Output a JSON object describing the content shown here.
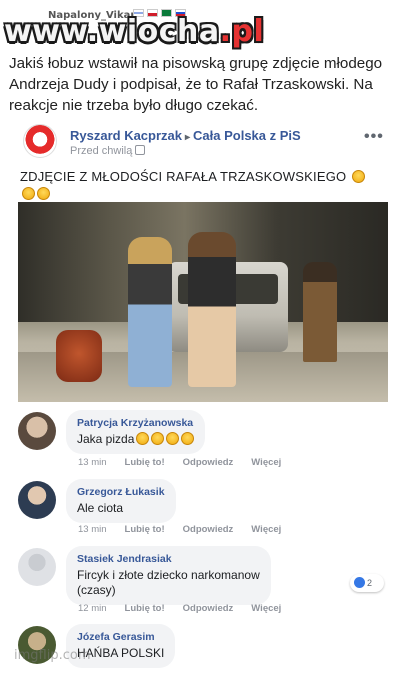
{
  "watermark": {
    "user": "Napalony_Vikar",
    "logo_main": "www.wiocha",
    "logo_dot_pl": ".pl",
    "footer": "imgflip.com"
  },
  "caption": "Jakiś łobuz wstawił na pisowską grupę zdjęcie młodego Andrzeja Dudy i podpisał, że to Rafał Trzaskowski. Na reakcje nie trzeba było długo czekać.",
  "post": {
    "author": "Ryszard Kacprzak",
    "arrow": "▸",
    "group": "Cała Polska z PiS",
    "time": "Przed chwilą",
    "more": "•••",
    "text": "ZDJĘCIE Z MŁODOŚCI RAFAŁA TRZASKOWSKIEGO"
  },
  "comments": [
    {
      "name": "Patrycja Krzyżanowska",
      "text": "Jaka pizda",
      "time": "13 min",
      "like": "Lubię to!",
      "reply": "Odpowiedz",
      "more": "Więcej"
    },
    {
      "name": "Grzegorz Łukasik",
      "text": "Ale ciota",
      "time": "13 min",
      "like": "Lubię to!",
      "reply": "Odpowiedz",
      "more": "Więcej"
    },
    {
      "name": "Stasiek Jendrasiak",
      "text_line1": "Fircyk i złote dziecko narkomanow",
      "text_line2": "(czasy)",
      "time": "12 min",
      "like": "Lubię to!",
      "reply": "Odpowiedz",
      "more": "Więcej",
      "reaction_count": "2"
    },
    {
      "name": "Józefa Gerasim",
      "text": "HAŃBA POLSKI"
    }
  ],
  "colors": {
    "fb_link": "#385898",
    "bubble_bg": "#f2f3f5",
    "meta_gray": "#90949c",
    "logo_red": "#e63232"
  }
}
